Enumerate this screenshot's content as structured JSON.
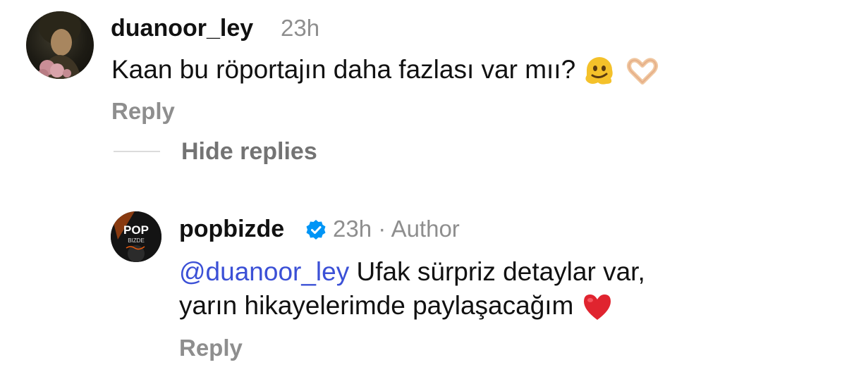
{
  "comment": {
    "username": "duanoor_ley",
    "time": "23h",
    "text": "Kaan bu röportajın daha fazlası var mıı? ",
    "emojis": [
      "melting-face",
      "heart-hands"
    ],
    "reply_label": "Reply"
  },
  "thread": {
    "hide_replies_label": "Hide replies"
  },
  "reply": {
    "username": "popbizde",
    "meta": "23h · Author",
    "mention": "@duanoor_ley",
    "text_line1": " Ufak sürpriz detaylar var,",
    "text_line2": "yarın hikayelerimde paylaşacağım",
    "emoji": "red-heart",
    "reply_label": "Reply",
    "avatar_text": {
      "line1": "POP",
      "line2": "BIZDE"
    }
  },
  "colors": {
    "username": "#111111",
    "muted": "#8e8e8e",
    "mention": "#3b50d6",
    "verified": "#0095f6",
    "heart": "#e0242f"
  }
}
